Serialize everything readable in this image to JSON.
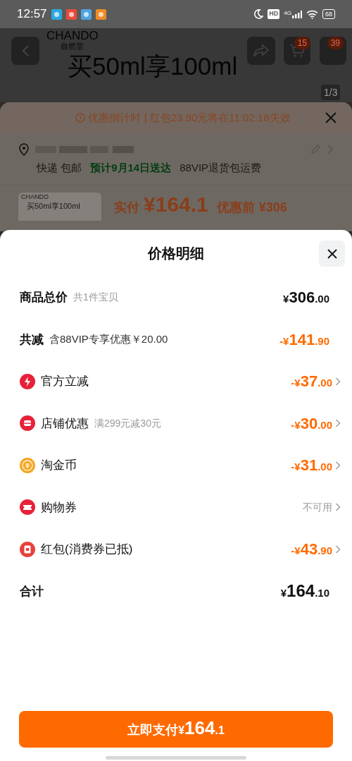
{
  "status_bar": {
    "time": "12:57",
    "network": "4G",
    "hd": "HD",
    "battery": "68"
  },
  "background_page": {
    "brand": "CHANDO",
    "brand_sub": "自然堂",
    "banner": "买50ml享100ml",
    "cart_badge": "15",
    "more_badge": "39",
    "image_counter": "1/3"
  },
  "order_sheet": {
    "countdown": "优惠倒计时 | 红包23.90元将在11:02:18失效",
    "delivery": "快递 包邮",
    "eta": "预计9月14日送达",
    "return_note": "88VIP退货包运费",
    "thumb_brand": "CHANDO",
    "thumb_text": "买50ml享100ml",
    "pay_label": "实付",
    "pay_amount": "¥164.1",
    "before_label": "优惠前",
    "before_amount": "¥306"
  },
  "price_sheet": {
    "title": "价格明细",
    "rows": [
      {
        "kind": "summary",
        "label": "商品总价",
        "note": "共1件宝贝",
        "amount": "¥306.00",
        "discount": false,
        "has_arrow": false
      },
      {
        "kind": "summary",
        "label": "共减",
        "note": "含88VIP专享优惠￥20.00",
        "amount": "-¥141.90",
        "discount": true,
        "has_arrow": false
      },
      {
        "kind": "bolt",
        "color": "#e8213a",
        "label": "官方立减",
        "amount": "-¥37.00",
        "discount": true,
        "has_arrow": true
      },
      {
        "kind": "shop",
        "color": "#e8213a",
        "label": "店铺优惠",
        "note": "满299元减30元",
        "amount": "-¥30.00",
        "discount": true,
        "has_arrow": true
      },
      {
        "kind": "coin",
        "color": "#f5a623",
        "label": "淘金币",
        "amount": "-¥31.00",
        "discount": true,
        "has_arrow": true
      },
      {
        "kind": "ticket",
        "color": "#e8213a",
        "label": "购物券",
        "status": "不可用",
        "has_arrow": true
      },
      {
        "kind": "envelope",
        "color": "#e8413a",
        "label": "红包(消费券已抵)",
        "amount": "-¥43.90",
        "discount": true,
        "has_arrow": true
      },
      {
        "kind": "total",
        "label": "合计",
        "amount": "¥164.10",
        "discount": false,
        "has_arrow": false
      }
    ],
    "pay_button": {
      "label": "立即支付",
      "amount": "¥164.1"
    }
  }
}
